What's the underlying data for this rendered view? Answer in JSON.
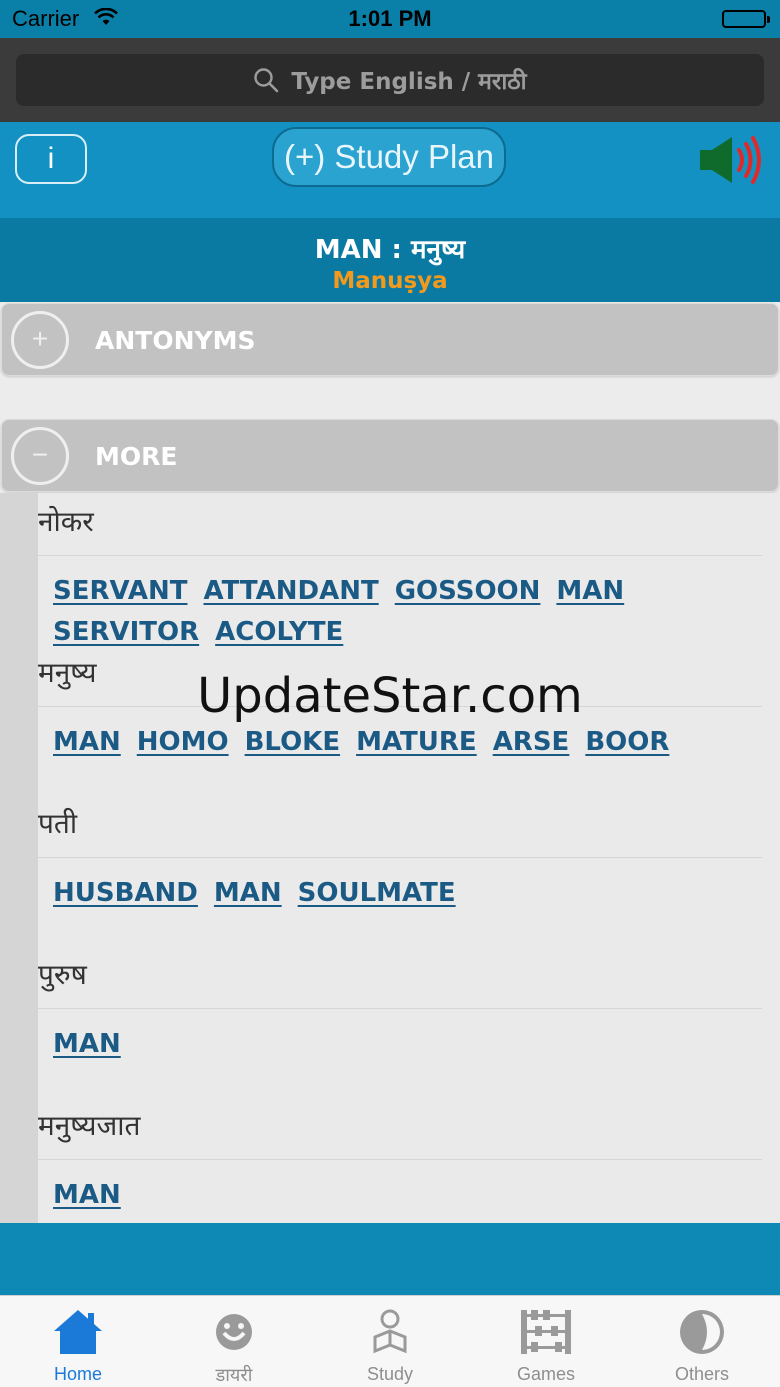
{
  "status_bar": {
    "carrier": "Carrier",
    "time": "1:01 PM"
  },
  "search": {
    "placeholder": "Type English / मराठी"
  },
  "toolbar": {
    "info_label": "i",
    "study_plan_label": "(+) Study Plan"
  },
  "word": {
    "title": "MAN : मनुष्य",
    "transliteration": "Manuṣya"
  },
  "sections": {
    "antonyms": {
      "label": "ANTONYMS",
      "toggle": "+"
    },
    "more": {
      "label": "MORE",
      "toggle": "−"
    }
  },
  "groups": [
    {
      "marathi": "नोकर",
      "words": [
        "SERVANT",
        "ATTANDANT",
        "GOSSOON",
        "MAN",
        "SERVITOR",
        "ACOLYTE"
      ]
    },
    {
      "marathi": "मनुष्य",
      "words": [
        "MAN",
        "HOMO",
        "BLOKE",
        "MATURE",
        "ARSE",
        "BOOR"
      ]
    },
    {
      "marathi": "पती",
      "words": [
        "HUSBAND",
        "MAN",
        "SOULMATE"
      ]
    },
    {
      "marathi": "पुरुष",
      "words": [
        "MAN"
      ]
    },
    {
      "marathi": "मनुष्यजात",
      "words": [
        "MAN"
      ]
    }
  ],
  "watermark": "UpdateStar.com",
  "tabs": [
    {
      "label": "Home",
      "icon": "home-icon",
      "active": true
    },
    {
      "label": "डायरी",
      "icon": "diary-icon",
      "active": false
    },
    {
      "label": "Study",
      "icon": "study-icon",
      "active": false
    },
    {
      "label": "Games",
      "icon": "games-icon",
      "active": false
    },
    {
      "label": "Others",
      "icon": "others-icon",
      "active": false
    }
  ],
  "colors": {
    "accent": "#1291c2",
    "header": "#0b7aa3",
    "link": "#1c5a86",
    "transliteration": "#f39a1c",
    "tab_active": "#1b7ad8"
  }
}
